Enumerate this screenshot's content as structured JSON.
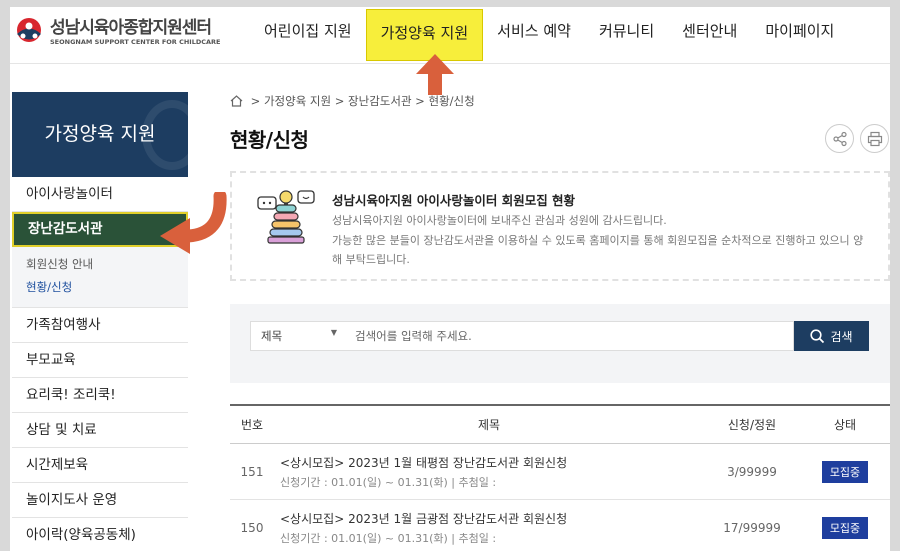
{
  "header": {
    "logo_kr": "성남시육아종합지원센터",
    "logo_en": "SEONGNAM SUPPORT CENTER FOR CHILDCARE",
    "nav": [
      "어린이집 지원",
      "가정양육 지원",
      "서비스 예약",
      "커뮤니티",
      "센터안내",
      "마이페이지"
    ],
    "active_nav": "가정양육 지원"
  },
  "sidebar": {
    "title": "가정양육 지원",
    "items": [
      "아이사랑놀이터",
      "장난감도서관",
      "가족참여행사",
      "부모교육",
      "요리쿡! 조리쿡!",
      "상담 및 치료",
      "시간제보육",
      "놀이지도사 운영",
      "아이락(양육공동체)"
    ],
    "active_item": "장난감도서관",
    "sub_items": [
      "회원신청 안내",
      "현황/신청"
    ],
    "active_sub": "현황/신청"
  },
  "breadcrumb": [
    "가정양육 지원",
    "장난감도서관",
    "현황/신청"
  ],
  "page_title": "현황/신청",
  "tools": {
    "share_icon": "share-icon",
    "print_icon": "print-icon"
  },
  "notice": {
    "title": "성남시육아지원 아이사랑놀이터 회원모집 현황",
    "line1": "성남시육아지원 아이사랑놀이터에 보내주신 관심과 성원에 감사드립니다.",
    "line2": "가능한 많은 분들이 장난감도서관을 이용하실 수 있도록 홈페이지를 통해 회원모집을 순차적으로 진행하고 있으니 양해 부탁드립니다."
  },
  "search": {
    "select_value": "제목",
    "placeholder": "검색어를 입력해 주세요.",
    "button_label": "검색"
  },
  "table": {
    "headers": {
      "no": "번호",
      "title": "제목",
      "apply": "신청/정원",
      "state": "상태"
    },
    "rows": [
      {
        "no": "151",
        "title": "<상시모집> 2023년 1월 태평점 장난감도서관 회원신청",
        "meta": "신청기간 : 01.01(일) ~ 01.31(화)  |  추첨일 :",
        "apply": "3/99999",
        "state": "모집중"
      },
      {
        "no": "150",
        "title": "<상시모집> 2023년 1월 금광점 장난감도서관 회원신청",
        "meta": "신청기간 : 01.01(일) ~ 01.31(화)  |  추첨일 :",
        "apply": "17/99999",
        "state": "모집중"
      }
    ]
  },
  "colors": {
    "brand_navy": "#1d3d61",
    "active_nav_bg": "#f7ee3b",
    "active_side_bg": "#2a5238",
    "annotation_arrow": "#d9603c",
    "badge": "#1e3e9e"
  }
}
